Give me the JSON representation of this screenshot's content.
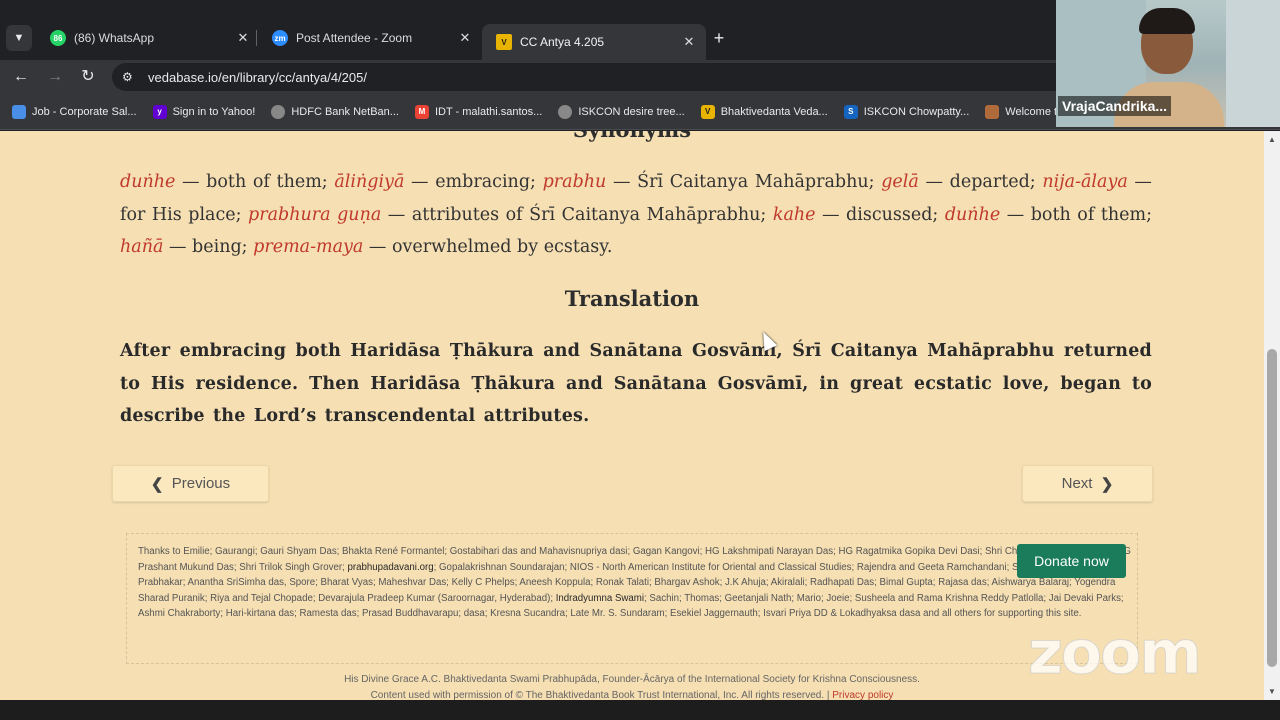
{
  "browser": {
    "tabs": [
      {
        "title": "(86) WhatsApp",
        "icon": "whatsapp-icon",
        "color": "#25d366",
        "badge": "86"
      },
      {
        "title": "Post Attendee - Zoom",
        "icon": "zoom-icon",
        "color": "#2d8cff",
        "badge": "zm"
      },
      {
        "title": "CC Antya 4.205",
        "icon": "vedabase-icon",
        "color": "#e8b400",
        "badge": "V"
      }
    ],
    "new_tab": "+",
    "url": "vedabase.io/en/library/cc/antya/4/205/",
    "bookmarks": [
      {
        "label": "Job - Corporate Sal...",
        "badge": "",
        "color": "#4a8fe7"
      },
      {
        "label": "Sign in to Yahoo!",
        "badge": "y",
        "color": "#6001d2"
      },
      {
        "label": "HDFC Bank NetBan...",
        "badge": "",
        "color": "#888888"
      },
      {
        "label": "IDT - malathi.santos...",
        "badge": "M",
        "color": "#ea4335"
      },
      {
        "label": "ISKCON desire tree...",
        "badge": "",
        "color": "#888888"
      },
      {
        "label": "Bhaktivedanta Veda...",
        "badge": "V",
        "color": "#e8b400"
      },
      {
        "label": "ISKCON Chowpatty...",
        "badge": "S",
        "color": "#1565c0"
      },
      {
        "label": "Welcome to",
        "badge": "",
        "color": "#b06a3b"
      }
    ]
  },
  "content": {
    "synonyms_heading": "Synonyms",
    "synonyms": [
      {
        "word": "duṅhe",
        "meaning": " — both of them; "
      },
      {
        "word": "āliṅgiyā",
        "meaning": " — embracing; "
      },
      {
        "word": "prabhu",
        "meaning": " — Śrī Caitanya Mahāprabhu; "
      },
      {
        "word": "gelā",
        "meaning": " — departed; "
      },
      {
        "word": "nija-ālaya",
        "meaning": " — for His place; "
      },
      {
        "word": "prabhura guṇa",
        "meaning": " — attributes of Śrī Caitanya Mahāprabhu; "
      },
      {
        "word": "kahe",
        "meaning": " — discussed; "
      },
      {
        "word": "duṅhe",
        "meaning": " — both of them; "
      },
      {
        "word": "hañā",
        "meaning": " — being; "
      },
      {
        "word": "prema-maya",
        "meaning": " — overwhelmed by ecstasy."
      }
    ],
    "translation_heading": "Translation",
    "translation": "After embracing both Haridāsa Ṭhākura and Sanātana Gosvāmī, Śrī Caitanya Mahāprabhu returned to His residence. Then Haridāsa Ṭhākura and Sanātana Gosvāmī, in great ecstatic love, began to describe the Lord’s transcendental attributes.",
    "prev_label": "Previous",
    "next_label": "Next"
  },
  "footer": {
    "thanks_a": "Thanks to Emilie; Gaurangi; Gauri Shyam Das; Bhakta René Formantel; Gostabihari das and Mahavisnupriya dasi; Gagan Kangovi; HG Lakshmipati Narayan Das; HG Ragatmika Gopika Devi Dasi; Shri Chander Mohan Gilhotra; HG Prashant Mukund Das; Shri Trilok Singh Grover; ",
    "thanks_link1": "prabhupadavani.org",
    "thanks_b": "; Gopalakrishnan Soundarajan; NIOS - North American Institute for Oriental and Classical Studies; Rajendra and Geeta Ramchandani; Sankarsan das; Jaykumar Prabhakar; Anantha SriSimha das, Spore; Bharat Vyas; Maheshvar Das; Kelly C Phelps; Aneesh Koppula; Ronak Talati; Bhargav Ashok; J.K Ahuja; Akiralali; Radhapati Das; Bimal Gupta; Rajasa das; Aishwarya Balaraj; Yogendra Sharad Puranik; Riya and Tejal Chopade; Devarajula Pradeep Kumar (Saroornagar, Hyderabad); ",
    "thanks_link2": "Indradyumna Swami",
    "thanks_c": "; Sachin; Thomas; Geetanjali Nath; Mario; Joeie; Susheela and Rama Krishna Reddy Patlolla; Jai Devaki Parks; Ashmi Chakraborty; Hari-kirtana das; Ramesta das; Prasad Buddhavarapu; dasa; Kresna Sucandra; Late Mr. S. Sundaram; Esekiel Jaggernauth; Isvari Priya DD & Lokadhyaksa dasa and all others for supporting this site.",
    "donate_label": "Donate now",
    "line1": "His Divine Grace A.C. Bhaktivedanta Swami Prabhupāda, Founder-Ācārya of the International Society for Krishna Consciousness.",
    "line2": "Content used with permission of © The Bhaktivedanta Book Trust International, Inc. All rights reserved. | ",
    "privacy_label": "Privacy policy"
  },
  "zoom": {
    "participant_name": "VrajaCandrika...",
    "watermark": "zoom"
  },
  "colors": {
    "page_bg": "#f5dfb3",
    "synonym_word": "#c0392b",
    "donate_bg": "#1a7c5a"
  }
}
